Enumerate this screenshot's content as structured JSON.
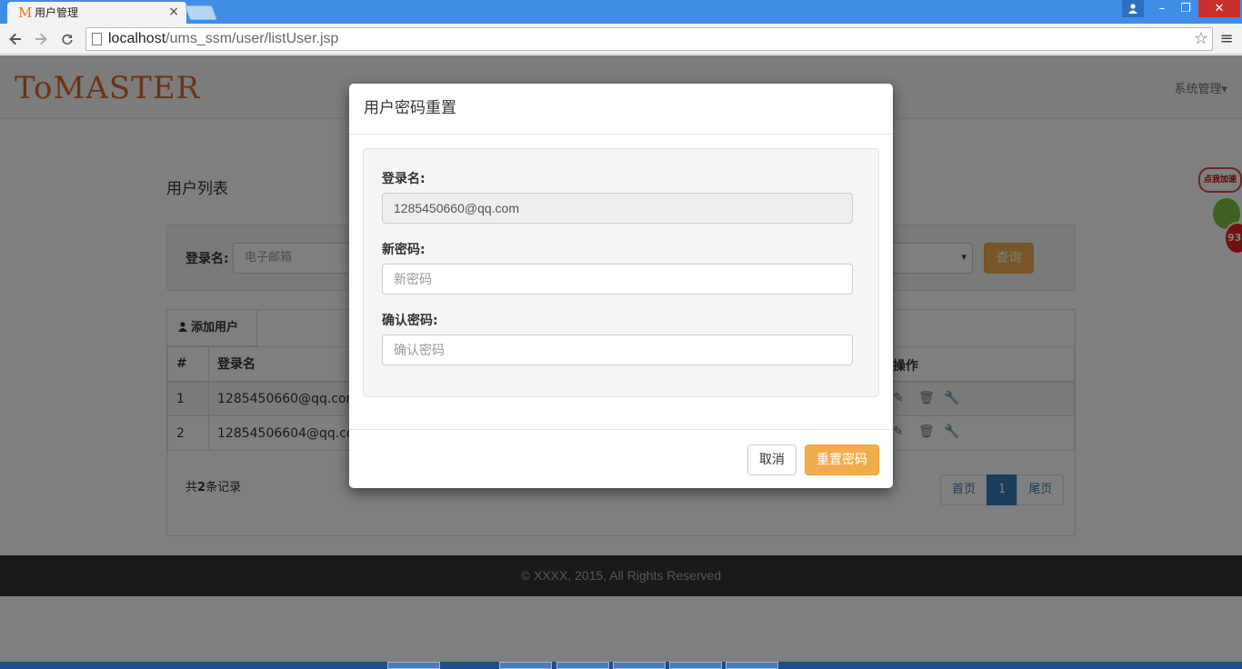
{
  "browser": {
    "tab_title": "用户管理",
    "tab_favicon": "M",
    "tab_close": "×",
    "url_host": "localhost",
    "url_path": "/ums_ssm/user/listUser.jsp",
    "icons": {
      "back": "back-arrow-icon",
      "forward": "forward-arrow-icon",
      "reload": "reload-icon",
      "bookmark": "star-icon",
      "menu": "hamburger-menu-icon",
      "page": "page-icon"
    },
    "window_controls": {
      "minimize": "–",
      "maximize": "❐",
      "close": "✕"
    }
  },
  "navbar": {
    "brand": "ToMASTER",
    "system_menu": "系统管理▾"
  },
  "user_list": {
    "title": "用户列表",
    "search": {
      "login_label": "登录名:",
      "login_placeholder": "电子邮箱",
      "select_caret": "▾",
      "query_button": "查询"
    },
    "add_user_button": "添加用户",
    "columns": [
      "#",
      "登录名"
    ],
    "ops_header": "操作",
    "rows": [
      {
        "index": "1",
        "login": "1285450660@qq.com"
      },
      {
        "index": "2",
        "login": "12854506604@qq.com"
      }
    ],
    "op_icons": {
      "edit": "✎",
      "delete": "🗑",
      "wrench": "🔧"
    },
    "total_prefix": "共",
    "total_count": "2",
    "total_suffix": "条记录",
    "pagination": {
      "first": "首页",
      "current": "1",
      "last": "尾页"
    }
  },
  "footer": {
    "text": "© XXXX, 2015, All Rights Reserved"
  },
  "float_badge": {
    "label": "点我加速",
    "number": "93"
  },
  "modal": {
    "title": "用户密码重置",
    "login_label": "登录名:",
    "login_value": "1285450660@qq.com",
    "new_password_label": "新密码:",
    "new_password_placeholder": "新密码",
    "confirm_password_label": "确认密码:",
    "confirm_password_placeholder": "确认密码",
    "cancel_button": "取消",
    "reset_button": "重置密码"
  },
  "colors": {
    "accent_orange": "#f0ad4e",
    "primary_blue": "#337ab7",
    "brand": "#d9692d",
    "footer_bg": "#333333"
  }
}
